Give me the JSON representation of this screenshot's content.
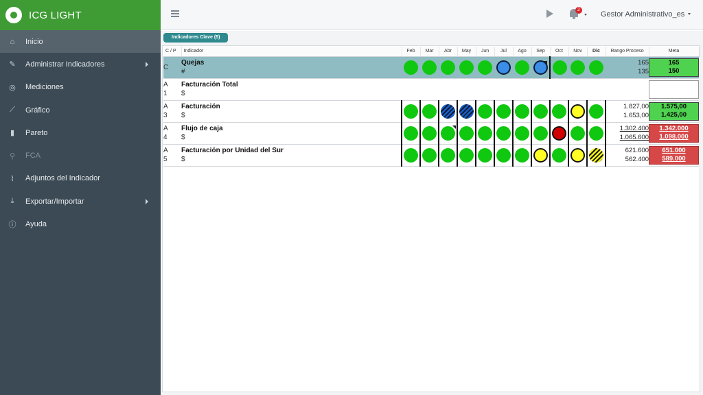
{
  "app": {
    "title": "ICG LIGHT"
  },
  "sidebar": {
    "items": [
      {
        "label": "Inicio",
        "icon": "home-icon",
        "glyph": "⌂",
        "active": true,
        "disabled": false,
        "submenu": false
      },
      {
        "label": "Administrar Indicadores",
        "icon": "wrench-icon",
        "glyph": "✎",
        "active": false,
        "disabled": false,
        "submenu": true
      },
      {
        "label": "Mediciones",
        "icon": "target-icon",
        "glyph": "◎",
        "active": false,
        "disabled": false,
        "submenu": false
      },
      {
        "label": "Gráfico",
        "icon": "line-chart-icon",
        "glyph": "⟋",
        "active": false,
        "disabled": false,
        "submenu": false
      },
      {
        "label": "Pareto",
        "icon": "bar-chart-icon",
        "glyph": "▮",
        "active": false,
        "disabled": false,
        "submenu": false
      },
      {
        "label": "FCA",
        "icon": "search-icon",
        "glyph": "⚲",
        "active": false,
        "disabled": true,
        "submenu": false
      },
      {
        "label": "Adjuntos del Indicador",
        "icon": "paperclip-icon",
        "glyph": "⌇",
        "active": false,
        "disabled": false,
        "submenu": false
      },
      {
        "label": "Exportar/Importar",
        "icon": "download-icon",
        "glyph": "⤓",
        "active": false,
        "disabled": false,
        "submenu": true
      },
      {
        "label": "Ayuda",
        "icon": "info-icon",
        "glyph": "ⓘ",
        "active": false,
        "disabled": false,
        "submenu": false
      }
    ]
  },
  "topbar": {
    "notification_count": "2",
    "user_name": "Gestor Administrativo_es"
  },
  "tab": {
    "label": "Indicadores Clave (5)"
  },
  "table": {
    "headers": {
      "cp": "C / P",
      "indicador": "Indicador",
      "months": [
        "Feb",
        "Mar",
        "Abr",
        "May",
        "Jun",
        "Jul",
        "Ago",
        "Sep",
        "Oct",
        "Nov",
        "Dic"
      ],
      "rango": "Rango Proceso",
      "meta": "Meta"
    },
    "rows": [
      {
        "cp": [
          "C",
          ""
        ],
        "name": "Quejas",
        "unit": "#",
        "highlight": true,
        "grid": false,
        "status": [
          "green",
          "green",
          "green",
          "green",
          "green",
          "blue",
          "green",
          "blue",
          "green",
          "green",
          "green"
        ],
        "flags": [
          false,
          false,
          false,
          false,
          false,
          false,
          false,
          true,
          false,
          false,
          false
        ],
        "rango": [
          "165",
          "135"
        ],
        "rango_underline": false,
        "meta": [
          "165",
          "150"
        ],
        "meta_color": "green"
      },
      {
        "cp": [
          "A",
          "1"
        ],
        "name": "Facturación Total",
        "unit": "$",
        "highlight": false,
        "grid": false,
        "status": [
          null,
          null,
          null,
          null,
          null,
          null,
          null,
          null,
          null,
          null,
          null
        ],
        "flags": [
          false,
          false,
          false,
          false,
          false,
          false,
          false,
          false,
          false,
          false,
          false
        ],
        "rango": [
          "",
          ""
        ],
        "rango_underline": false,
        "meta": [
          "",
          ""
        ],
        "meta_color": "empty"
      },
      {
        "cp": [
          "A",
          "3"
        ],
        "name": "Facturación",
        "unit": "$",
        "highlight": false,
        "grid": true,
        "status": [
          "green",
          "green",
          "hatch-blue",
          "hatch-blue",
          "green",
          "green",
          "green",
          "green",
          "green",
          "yellow",
          "green"
        ],
        "flags": [
          false,
          false,
          false,
          false,
          false,
          false,
          false,
          false,
          false,
          false,
          false
        ],
        "rango": [
          "1.827,00",
          "1.653,00"
        ],
        "rango_underline": false,
        "meta": [
          "1.575,00",
          "1.425,00"
        ],
        "meta_color": "green"
      },
      {
        "cp": [
          "A",
          "4"
        ],
        "name": "Flujo de caja",
        "unit": "$",
        "highlight": false,
        "grid": true,
        "status": [
          "green",
          "green",
          "green",
          "green",
          "green",
          "green",
          "green",
          "green",
          "red",
          "green",
          "green"
        ],
        "flags": [
          false,
          false,
          true,
          false,
          false,
          false,
          false,
          false,
          false,
          false,
          false
        ],
        "rango": [
          "1.302.400",
          "1.065.600"
        ],
        "rango_underline": true,
        "meta": [
          "1.342.000",
          "1.098.000"
        ],
        "meta_color": "red"
      },
      {
        "cp": [
          "A",
          "5"
        ],
        "name": "Facturación por Unidad del Sur",
        "unit": "$",
        "highlight": false,
        "grid": true,
        "status": [
          "green",
          "green",
          "green",
          "green",
          "green",
          "green",
          "green",
          "yellow",
          "green",
          "yellow",
          "hatch-yellow"
        ],
        "flags": [
          false,
          false,
          false,
          false,
          false,
          false,
          false,
          false,
          false,
          false,
          false
        ],
        "rango": [
          "621.600",
          "562.400"
        ],
        "rango_underline": false,
        "meta": [
          "651.000",
          "589.000"
        ],
        "meta_color": "red"
      }
    ]
  }
}
